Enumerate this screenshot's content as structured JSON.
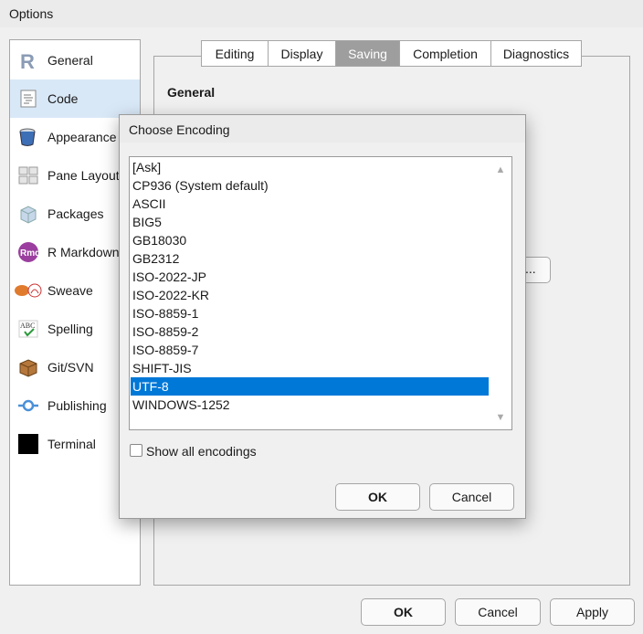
{
  "window": {
    "title": "Options"
  },
  "sidebar": {
    "items": [
      {
        "label": "General",
        "icon": "r-logo-icon"
      },
      {
        "label": "Code",
        "icon": "code-document-icon",
        "selected": true
      },
      {
        "label": "Appearance",
        "icon": "paint-bucket-icon"
      },
      {
        "label": "Pane Layout",
        "icon": "pane-layout-icon"
      },
      {
        "label": "Packages",
        "icon": "package-box-icon"
      },
      {
        "label": "R Markdown",
        "icon": "rmd-icon"
      },
      {
        "label": "Sweave",
        "icon": "sweave-icon"
      },
      {
        "label": "Spelling",
        "icon": "spelling-abc-icon"
      },
      {
        "label": "Git/SVN",
        "icon": "git-box-icon"
      },
      {
        "label": "Publishing",
        "icon": "publish-icon"
      },
      {
        "label": "Terminal",
        "icon": "terminal-icon"
      }
    ]
  },
  "tabs": [
    {
      "label": "Editing"
    },
    {
      "label": "Display"
    },
    {
      "label": "Saving",
      "active": true
    },
    {
      "label": "Completion"
    },
    {
      "label": "Diagnostics"
    }
  ],
  "content": {
    "section_heading": "General",
    "partial_button_label": "..."
  },
  "dialog": {
    "title": "Choose Encoding",
    "encodings": [
      "[Ask]",
      "CP936 (System default)",
      "ASCII",
      "BIG5",
      "GB18030",
      "GB2312",
      "ISO-2022-JP",
      "ISO-2022-KR",
      "ISO-8859-1",
      "ISO-8859-2",
      "ISO-8859-7",
      "SHIFT-JIS",
      "UTF-8",
      "WINDOWS-1252"
    ],
    "selected_encoding": "UTF-8",
    "show_all_label": "Show all encodings",
    "show_all_checked": false,
    "ok_label": "OK",
    "cancel_label": "Cancel"
  },
  "footer": {
    "ok_label": "OK",
    "cancel_label": "Cancel",
    "apply_label": "Apply"
  },
  "colors": {
    "selection": "#0078d7",
    "sidebar_selected": "#d9e8f7",
    "active_tab": "#9e9e9e"
  }
}
